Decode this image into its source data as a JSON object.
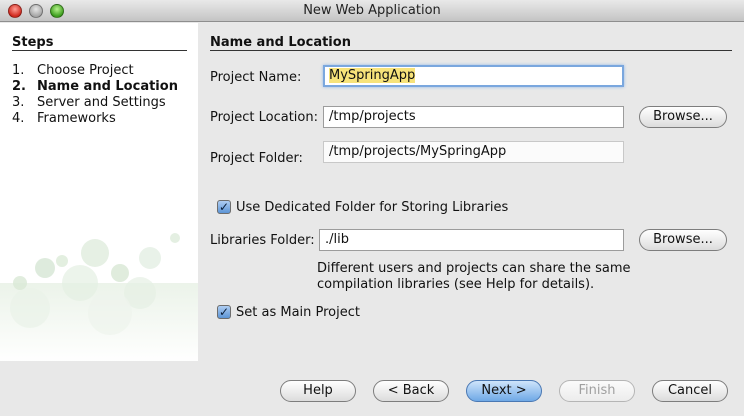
{
  "window": {
    "title": "New Web Application"
  },
  "steps": {
    "heading": "Steps",
    "items": [
      {
        "number": "1.",
        "label": "Choose Project",
        "current": false
      },
      {
        "number": "2.",
        "label": "Name and Location",
        "current": true
      },
      {
        "number": "3.",
        "label": "Server and Settings",
        "current": false
      },
      {
        "number": "4.",
        "label": "Frameworks",
        "current": false
      }
    ]
  },
  "form": {
    "section_title": "Name and Location",
    "project_name": {
      "label": "Project Name:",
      "value": "MySpringApp"
    },
    "project_location": {
      "label": "Project Location:",
      "value": "/tmp/projects",
      "browse": "Browse..."
    },
    "project_folder": {
      "label": "Project Folder:",
      "value": "/tmp/projects/MySpringApp"
    },
    "dedicated_folder": {
      "label": "Use Dedicated Folder for Storing Libraries",
      "checked": true
    },
    "libraries_folder": {
      "label": "Libraries Folder:",
      "value": "./lib",
      "browse": "Browse..."
    },
    "libraries_help": "Different users and projects can share the same compilation libraries (see Help for details).",
    "main_project": {
      "label": "Set as Main Project",
      "checked": true
    }
  },
  "buttons": {
    "help": "Help",
    "back": "< Back",
    "next": "Next >",
    "finish": "Finish",
    "cancel": "Cancel"
  },
  "colors": {
    "default_button": "#6fa8e6",
    "selection_highlight": "#f7e37a",
    "focus_ring": "#7aa7de"
  }
}
